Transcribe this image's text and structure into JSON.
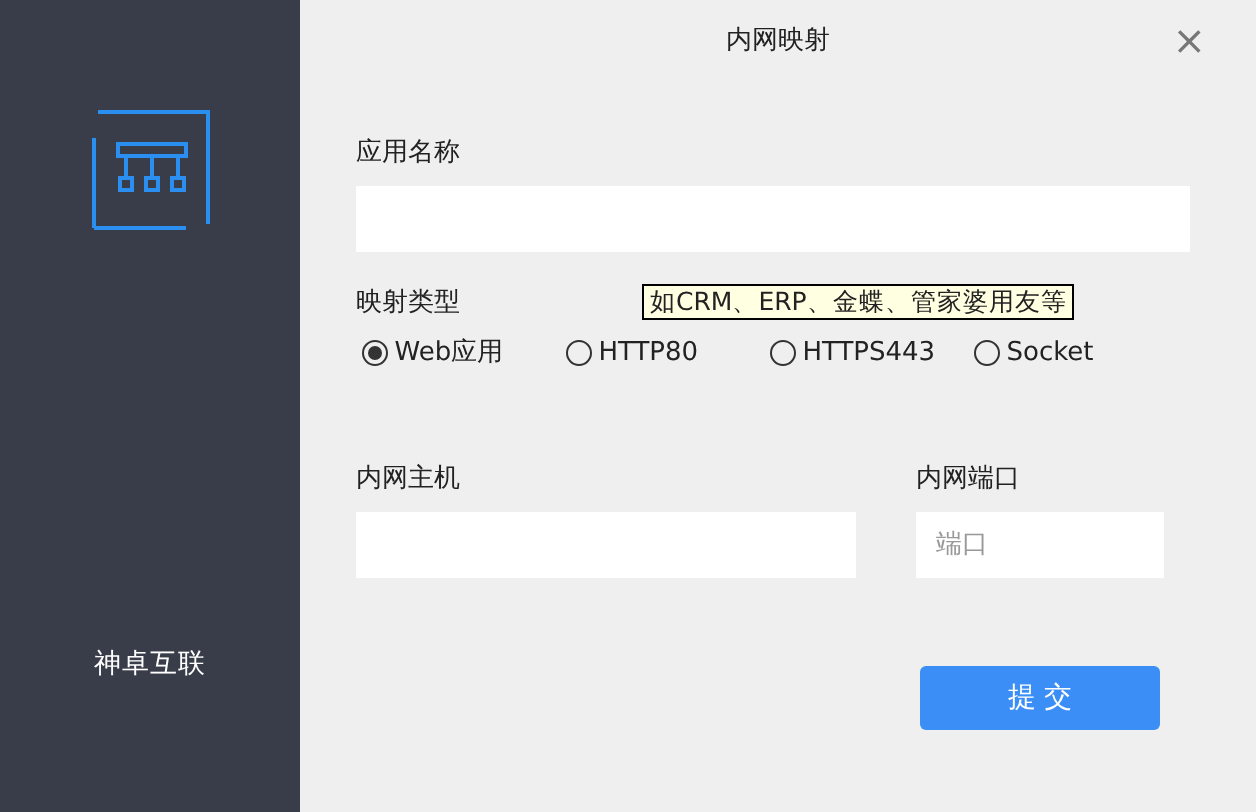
{
  "sidebar": {
    "brand": "神卓互联"
  },
  "dialog": {
    "title": "内网映射",
    "close": "×"
  },
  "app_name": {
    "label": "应用名称"
  },
  "mapping_type": {
    "label": "映射类型",
    "tooltip": "如CRM、ERP、金蝶、管家婆用友等",
    "options": [
      {
        "label": "Web应用",
        "selected": true
      },
      {
        "label": "HTTP80",
        "selected": false
      },
      {
        "label": "HTTPS443",
        "selected": false
      },
      {
        "label": "Socket",
        "selected": false
      }
    ]
  },
  "host": {
    "label": "内网主机"
  },
  "port": {
    "label": "内网端口",
    "placeholder": "端口"
  },
  "submit": "提 交"
}
